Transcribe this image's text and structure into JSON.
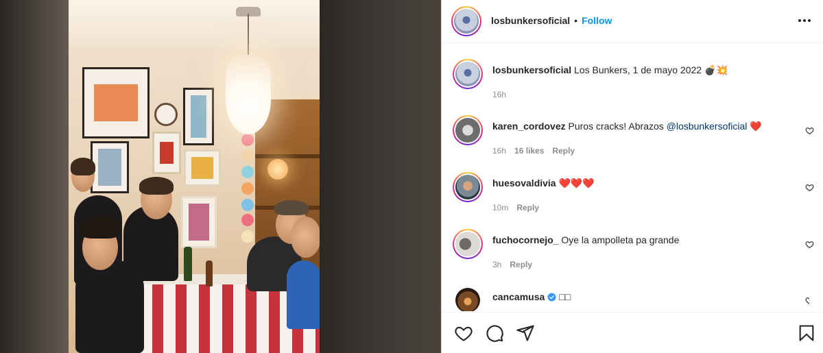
{
  "post": {
    "author": "losbunkersoficial",
    "follow_label": "Follow",
    "separator": "•",
    "caption_author": "losbunkersoficial",
    "caption_text": "Los Bunkers, 1 de mayo 2022",
    "caption_emojis": "💣💥",
    "caption_time": "16h"
  },
  "comments": [
    {
      "user": "karen_cordovez",
      "text": "Puros cracks! Abrazos",
      "mention": "@losbunkersoficial",
      "suffix": "❤️",
      "time": "16h",
      "likes": "16 likes",
      "reply": "Reply"
    },
    {
      "user": "huesovaldivia",
      "text": "❤️❤️❤️",
      "time": "10m",
      "reply": "Reply"
    },
    {
      "user": "fuchocornejo_",
      "text": "Oye la ampolleta pa grande",
      "time": "3h",
      "reply": "Reply"
    },
    {
      "user": "cancamusa",
      "text": "□□"
    }
  ],
  "icons": {
    "like": "heart-icon",
    "comment": "comment-icon",
    "share": "share-icon",
    "save": "bookmark-icon",
    "more": "more-icon",
    "verified": "verified-badge-icon"
  },
  "colors": {
    "follow": "#0095f6",
    "mention": "#00376b",
    "muted": "#8e8e8e",
    "verified": "#3897f0"
  }
}
